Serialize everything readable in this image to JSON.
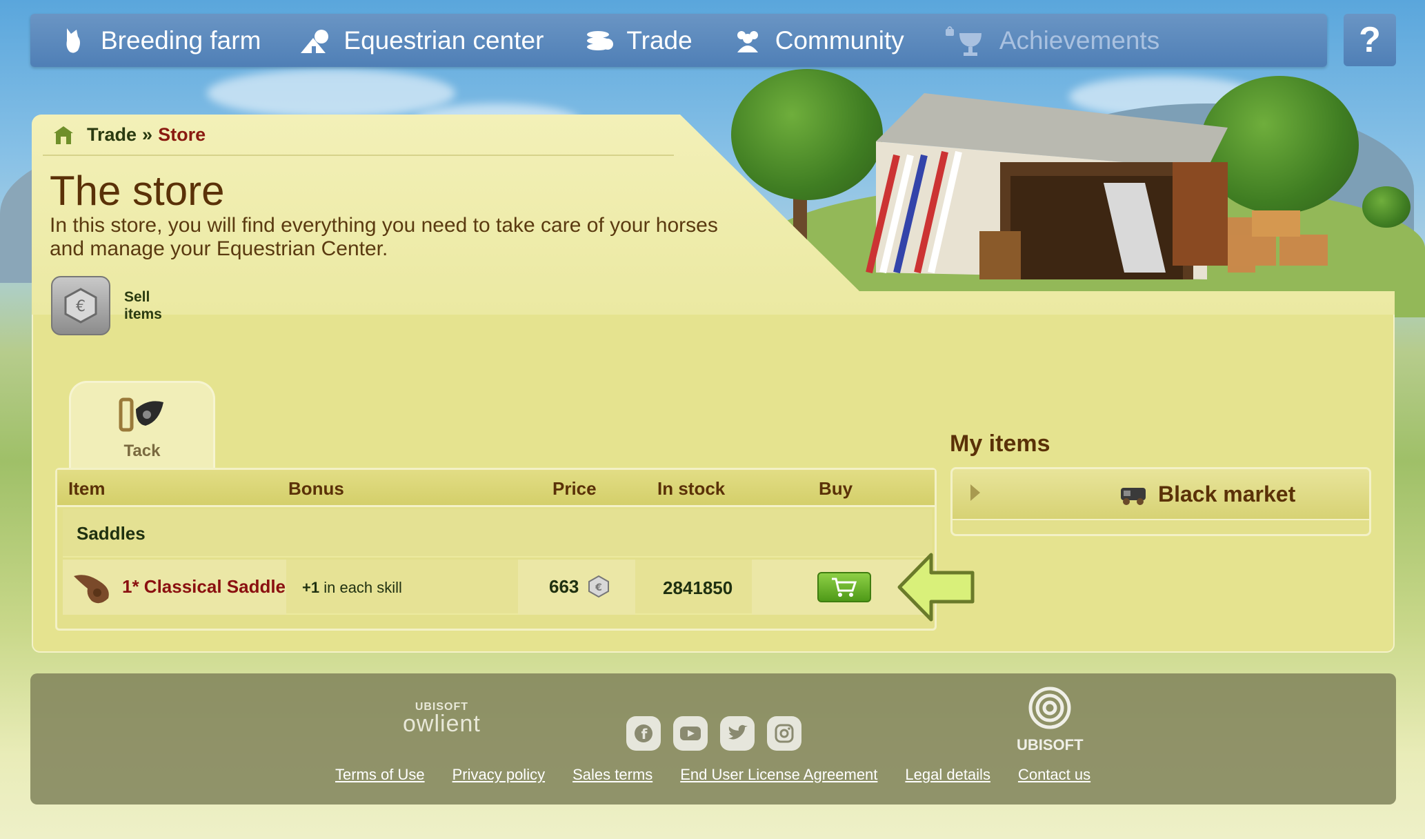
{
  "nav": {
    "items": [
      {
        "label": "Breeding farm",
        "icon": "horse-head-icon"
      },
      {
        "label": "Equestrian center",
        "icon": "center-icon"
      },
      {
        "label": "Trade",
        "icon": "coins-icon"
      },
      {
        "label": "Community",
        "icon": "people-icon"
      },
      {
        "label": "Achievements",
        "icon": "trophy-icon",
        "locked": true
      }
    ],
    "help_label": "?"
  },
  "breadcrumb": {
    "trade": "Trade",
    "separator": "»",
    "store": "Store"
  },
  "page": {
    "title": "The store",
    "description": "In this store, you will find everything you need to take care of your horses and manage your Equestrian Center."
  },
  "sell": {
    "label": "Sell items"
  },
  "tabs": [
    {
      "label": "Tack",
      "icon": "tack-icon"
    }
  ],
  "table": {
    "headers": {
      "item": "Item",
      "bonus": "Bonus",
      "price": "Price",
      "stock": "In stock",
      "buy": "Buy"
    },
    "section": "Saddles",
    "rows": [
      {
        "name": "1* Classical Saddle",
        "bonus_value": "+1",
        "bonus_text": "in each skill",
        "price": "663",
        "stock": "2841850"
      }
    ]
  },
  "my_items": {
    "title": "My items",
    "black_market": "Black market"
  },
  "footer": {
    "owlient_small": "UBISOFT",
    "owlient_big": "owlient",
    "ubisoft": "UBISOFT",
    "links": [
      "Terms of Use",
      "Privacy policy",
      "Sales terms",
      "End User License Agreement",
      "Legal details",
      "Contact us"
    ]
  },
  "colors": {
    "nav": "#5a88bf",
    "panel": "#e5e38f",
    "title": "#5a3108",
    "item_name": "#8a1010",
    "buy": "#6bb22c"
  }
}
